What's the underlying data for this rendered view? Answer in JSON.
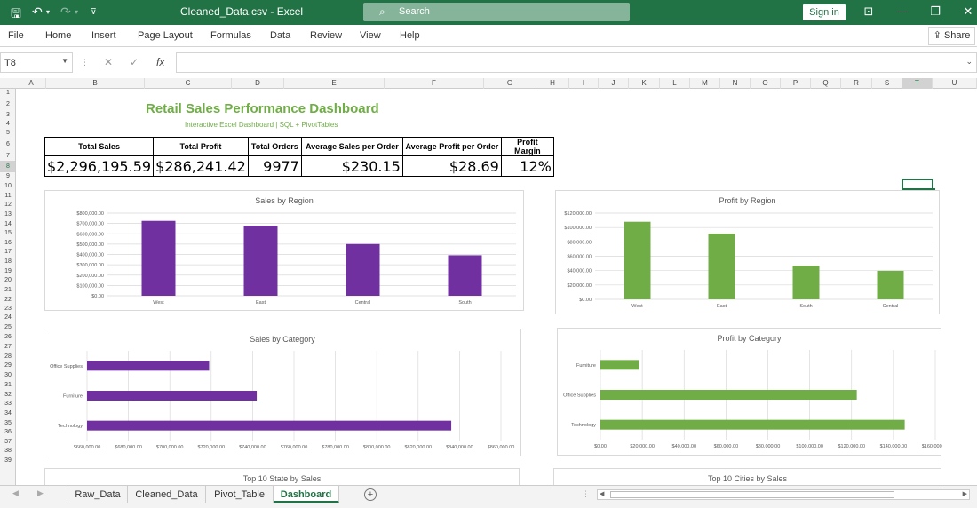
{
  "window": {
    "title": "Cleaned_Data.csv  -  Excel",
    "search_placeholder": "Search",
    "signin_label": "Sign in",
    "minimize": "—",
    "restore": "❐",
    "close": "✕",
    "ribbon_toggle": "⊡"
  },
  "menu": {
    "items": [
      "File",
      "Home",
      "Insert",
      "Page Layout",
      "Formulas",
      "Data",
      "Review",
      "View",
      "Help"
    ],
    "share_label": "Share"
  },
  "formula_bar": {
    "name_box": "T8",
    "fx": "fx",
    "value": ""
  },
  "columns": [
    "A",
    "B",
    "C",
    "D",
    "E",
    "F",
    "G",
    "H",
    "I",
    "J",
    "K",
    "L",
    "M",
    "N",
    "O",
    "P",
    "Q",
    "R",
    "S",
    "T",
    "U"
  ],
  "rows": [
    "1",
    "2",
    "3",
    "4",
    "5",
    "6",
    "7",
    "8",
    "9",
    "10",
    "11",
    "12",
    "13",
    "14",
    "15",
    "16",
    "17",
    "18",
    "19",
    "20",
    "21",
    "22",
    "23",
    "24",
    "25",
    "26",
    "27",
    "28",
    "29",
    "30",
    "31",
    "32",
    "33",
    "34",
    "35",
    "36",
    "37",
    "38",
    "39"
  ],
  "dashboard": {
    "title": "Retail Sales Performance Dashboard",
    "subtitle": "Interactive Excel Dashboard | SQL + PivotTables",
    "kpi_headers": [
      "Total Sales",
      "Total Profit",
      "Total Orders",
      "Average Sales per Order",
      "Average Profit per Order",
      "Profit Margin"
    ],
    "kpi_values": [
      "$2,296,195.59",
      "$286,241.42",
      "9977",
      "$230.15",
      "$28.69",
      "12%"
    ]
  },
  "colors": {
    "excel_green": "#217346",
    "purple": "#7030a0",
    "green": "#70ad47"
  },
  "chart_data": [
    {
      "type": "bar",
      "title": "Sales by Region",
      "categories": [
        "West",
        "East",
        "Central",
        "South"
      ],
      "values": [
        725000,
        678000,
        501000,
        392000
      ],
      "ylim": [
        0,
        800000
      ],
      "yticks": [
        "$0.00",
        "$100,000.00",
        "$200,000.00",
        "$300,000.00",
        "$400,000.00",
        "$500,000.00",
        "$600,000.00",
        "$700,000.00",
        "$800,000.00"
      ],
      "color": "#7030a0",
      "grid": true
    },
    {
      "type": "bar",
      "title": "Profit by Region",
      "categories": [
        "West",
        "East",
        "South",
        "Central"
      ],
      "values": [
        108000,
        91500,
        46700,
        39700
      ],
      "ylim": [
        0,
        120000
      ],
      "yticks": [
        "$0.00",
        "$20,000.00",
        "$40,000.00",
        "$60,000.00",
        "$80,000.00",
        "$100,000.00",
        "$120,000.00"
      ],
      "color": "#70ad47",
      "grid": true
    },
    {
      "type": "bar",
      "orientation": "horizontal",
      "title": "Sales by Category",
      "categories": [
        "Office Supplies",
        "Furniture",
        "Technology"
      ],
      "values": [
        719000,
        742000,
        836000
      ],
      "xlim": [
        660000,
        860000
      ],
      "xticks": [
        "$660,000.00",
        "$680,000.00",
        "$700,000.00",
        "$720,000.00",
        "$740,000.00",
        "$760,000.00",
        "$780,000.00",
        "$800,000.00",
        "$820,000.00",
        "$840,000.00",
        "$860,000.00"
      ],
      "color": "#7030a0",
      "grid": true
    },
    {
      "type": "bar",
      "orientation": "horizontal",
      "title": "Profit by Category",
      "categories": [
        "Furniture",
        "Office Supplies",
        "Technology"
      ],
      "values": [
        18400,
        122500,
        145400
      ],
      "xlim": [
        0,
        160000
      ],
      "xticks": [
        "$0.00",
        "$20,000.00",
        "$40,000.00",
        "$60,000.00",
        "$80,000.00",
        "$100,000.00",
        "$120,000.00",
        "$140,000.00",
        "$160,000.00"
      ],
      "color": "#70ad47",
      "grid": true
    }
  ],
  "bottom_charts": {
    "states_title": "Top 10 State by Sales",
    "cities_title": "Top 10 Cities by Sales"
  },
  "sheet_tabs": [
    "Raw_Data",
    "Cleaned_Data",
    "Pivot_Table",
    "Dashboard"
  ],
  "active_tab": "Dashboard"
}
